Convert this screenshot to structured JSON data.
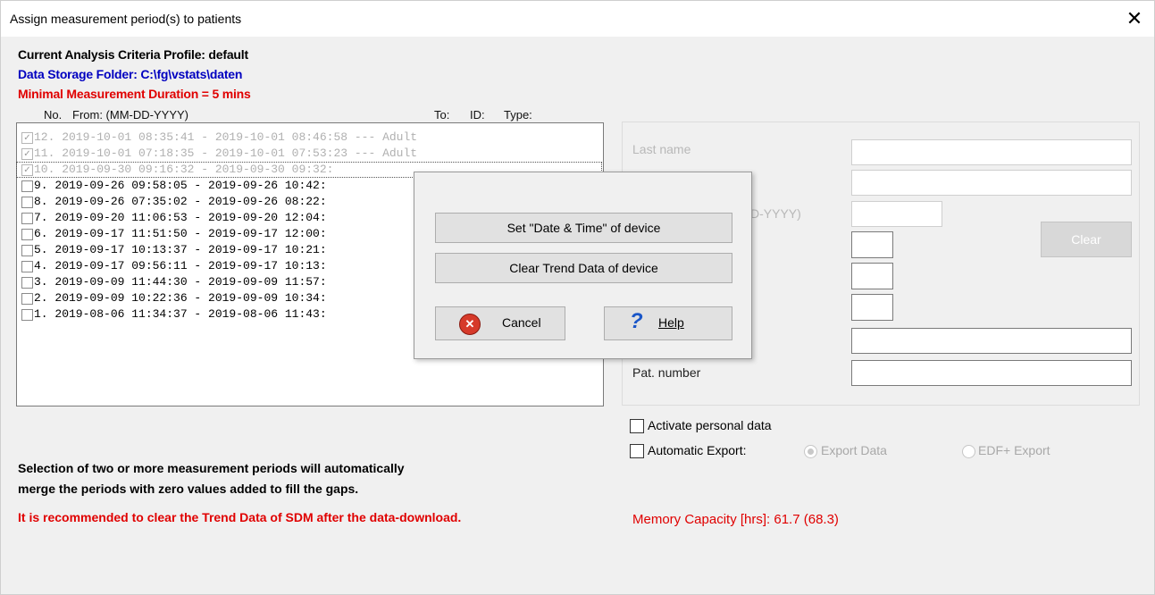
{
  "window": {
    "title": "Assign measurement period(s) to patients",
    "close_glyph": "✕"
  },
  "header": {
    "profile": "Current Analysis Criteria Profile:  default",
    "storage": "Data Storage Folder: C:\\fg\\vstats\\daten",
    "min_duration": "Minimal Measurement Duration = 5 mins",
    "colors": {
      "storage": "#0000c0",
      "warning": "#e00000"
    }
  },
  "columns": {
    "no": "No.",
    "from": "From: (MM-DD-YYYY)",
    "to": "To:",
    "id": "ID:",
    "type": "Type:"
  },
  "list_rows": [
    {
      "text": "12. 2019-10-01 08:35:41 - 2019-10-01 08:46:58  ---  Adult",
      "checked": true,
      "disabled": true
    },
    {
      "text": "11. 2019-10-01 07:18:35 - 2019-10-01 07:53:23  ---  Adult",
      "checked": true,
      "disabled": true
    },
    {
      "text": "10. 2019-09-30 09:16:32 - 2019-09-30 09:32:",
      "checked": true,
      "disabled": true
    },
    {
      "text": " 9. 2019-09-26 09:58:05 - 2019-09-26 10:42:",
      "checked": false,
      "disabled": false
    },
    {
      "text": " 8. 2019-09-26 07:35:02 - 2019-09-26 08:22:",
      "checked": false,
      "disabled": false
    },
    {
      "text": " 7. 2019-09-20 11:06:53 - 2019-09-20 12:04:",
      "checked": false,
      "disabled": false
    },
    {
      "text": " 6. 2019-09-17 11:51:50 - 2019-09-17 12:00:",
      "checked": false,
      "disabled": false
    },
    {
      "text": " 5. 2019-09-17 10:13:37 - 2019-09-17 10:21:",
      "checked": false,
      "disabled": false
    },
    {
      "text": " 4. 2019-09-17 09:56:11 - 2019-09-17 10:13:",
      "checked": false,
      "disabled": false
    },
    {
      "text": " 3. 2019-09-09 11:44:30 - 2019-09-09 11:57:",
      "checked": false,
      "disabled": false
    },
    {
      "text": " 2. 2019-09-09 10:22:36 - 2019-09-09 10:34:",
      "checked": false,
      "disabled": false
    },
    {
      "text": " 1. 2019-08-06 11:34:37 - 2019-08-06 11:43:",
      "checked": false,
      "disabled": false
    }
  ],
  "patient": {
    "last_name_label": "Last name",
    "dob_partial_label": "D-YYYY)",
    "pat_number_label": "Pat. number",
    "clear_label": "Clear"
  },
  "options": {
    "activate_personal": "Activate personal data",
    "automatic_export": "Automatic Export:",
    "export_data": "Export Data",
    "edf_export": "EDF+ Export"
  },
  "notes": {
    "merge_line1": "Selection of two or more measurement periods will automatically",
    "merge_line2": "merge the periods with zero values added to fill the gaps.",
    "recommend": "It is recommended to clear the Trend Data of SDM after the data-download.",
    "memory": "Memory Capacity [hrs]: 61.7 (68.3)"
  },
  "popup": {
    "set_datetime": "Set \"Date & Time\" of device",
    "clear_trend": "Clear Trend Data of device",
    "cancel": "Cancel",
    "help": "Help",
    "help_icon_glyph": "?",
    "cancel_icon_glyph": "✕"
  }
}
